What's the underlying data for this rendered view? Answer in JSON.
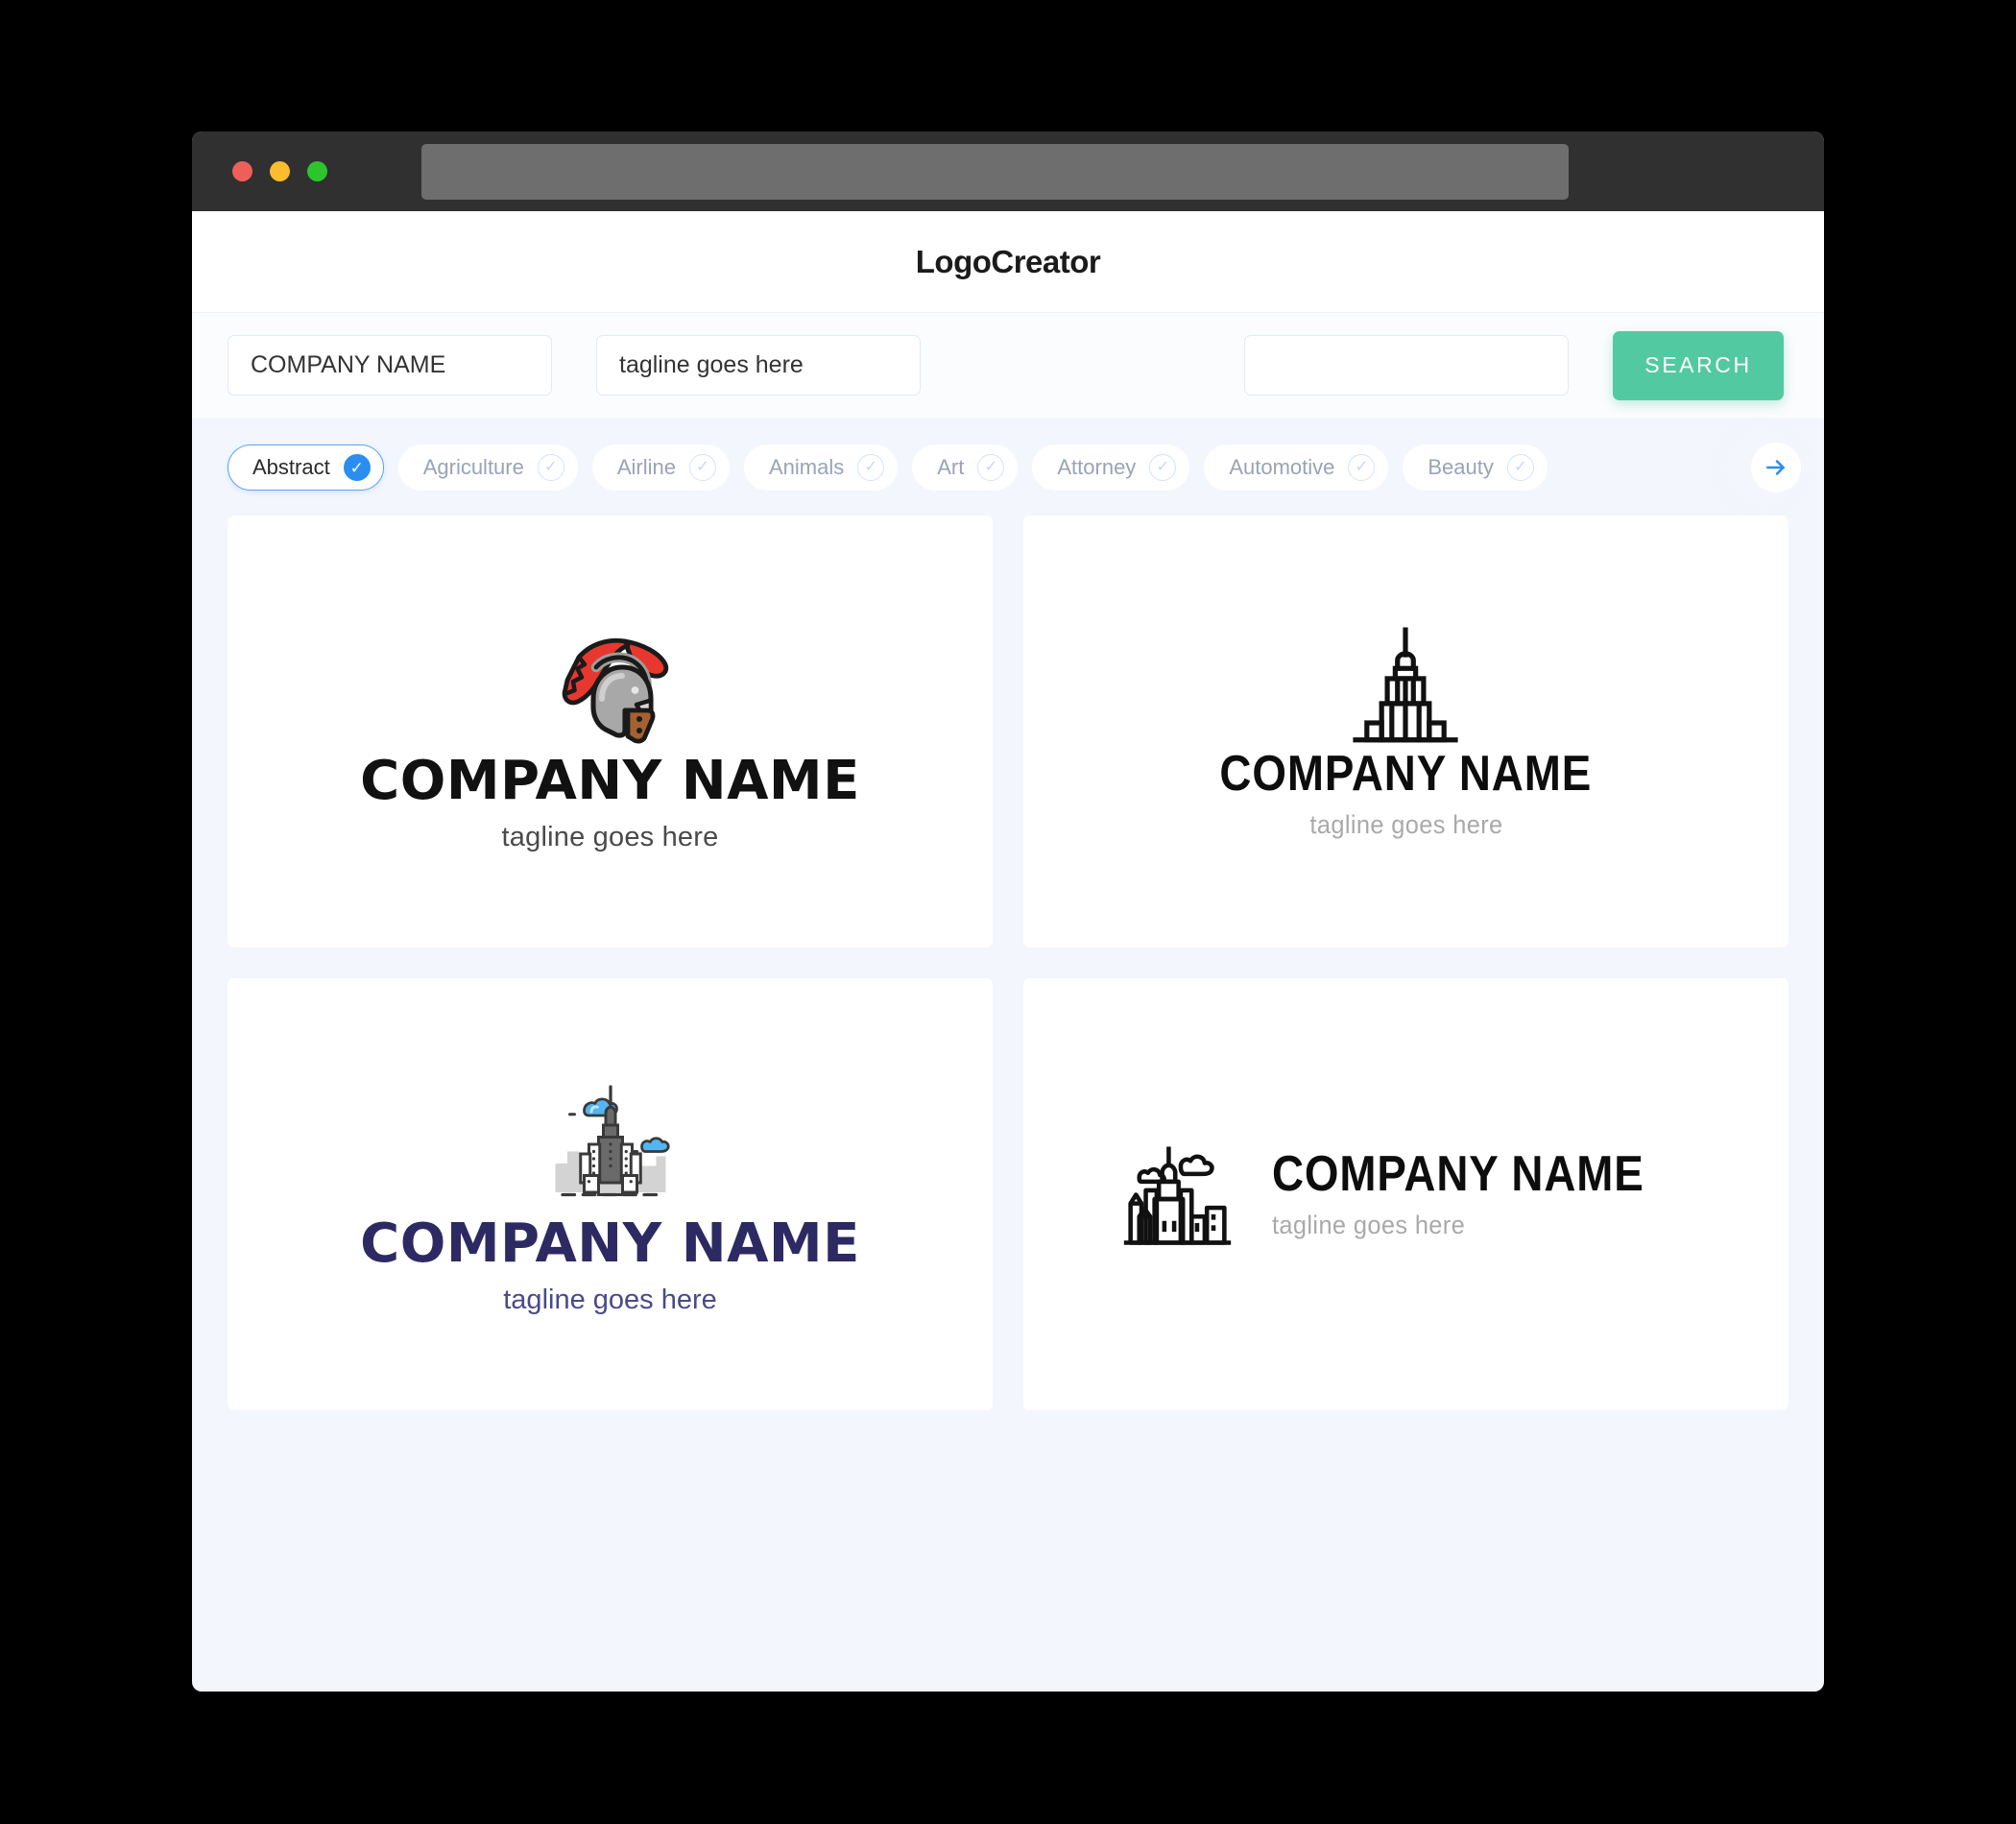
{
  "window": {
    "controls": [
      "close",
      "minimize",
      "maximize"
    ],
    "address_bar_value": ""
  },
  "header": {
    "title": "LogoCreator"
  },
  "search": {
    "company_value": "COMPANY NAME",
    "company_placeholder": "COMPANY NAME",
    "tagline_value": "tagline goes here",
    "tagline_placeholder": "tagline goes here",
    "extra_value": "",
    "extra_placeholder": "",
    "button_label": "SEARCH",
    "button_color": "#52c9a0"
  },
  "categories": {
    "selected": "Abstract",
    "accent_color": "#2a8ef0",
    "next_icon": "arrow-right-icon",
    "items": [
      {
        "label": "Abstract",
        "selected": true
      },
      {
        "label": "Agriculture",
        "selected": false
      },
      {
        "label": "Airline",
        "selected": false
      },
      {
        "label": "Animals",
        "selected": false
      },
      {
        "label": "Art",
        "selected": false
      },
      {
        "label": "Attorney",
        "selected": false
      },
      {
        "label": "Automotive",
        "selected": false
      },
      {
        "label": "Beauty",
        "selected": false
      }
    ]
  },
  "results": {
    "cards": [
      {
        "icon": "roman-helmet-icon",
        "name": "COMPANY NAME",
        "tagline": "tagline goes here",
        "name_color": "#111111",
        "tagline_color": "#4a4a4a",
        "layout": "stacked"
      },
      {
        "icon": "skyscraper-outline-icon",
        "name": "COMPANY NAME",
        "tagline": "tagline goes here",
        "name_color": "#0d0d0d",
        "tagline_color": "#a9a9a9",
        "layout": "stacked"
      },
      {
        "icon": "empire-state-clouds-icon",
        "name": "COMPANY NAME",
        "tagline": "tagline goes here",
        "name_color": "#2d2a63",
        "tagline_color": "#4a4a8a",
        "layout": "stacked"
      },
      {
        "icon": "city-skyline-clouds-icon",
        "name": "COMPANY NAME",
        "tagline": "tagline goes here",
        "name_color": "#0d0d0d",
        "tagline_color": "#a9a9a9",
        "layout": "horizontal"
      }
    ]
  }
}
